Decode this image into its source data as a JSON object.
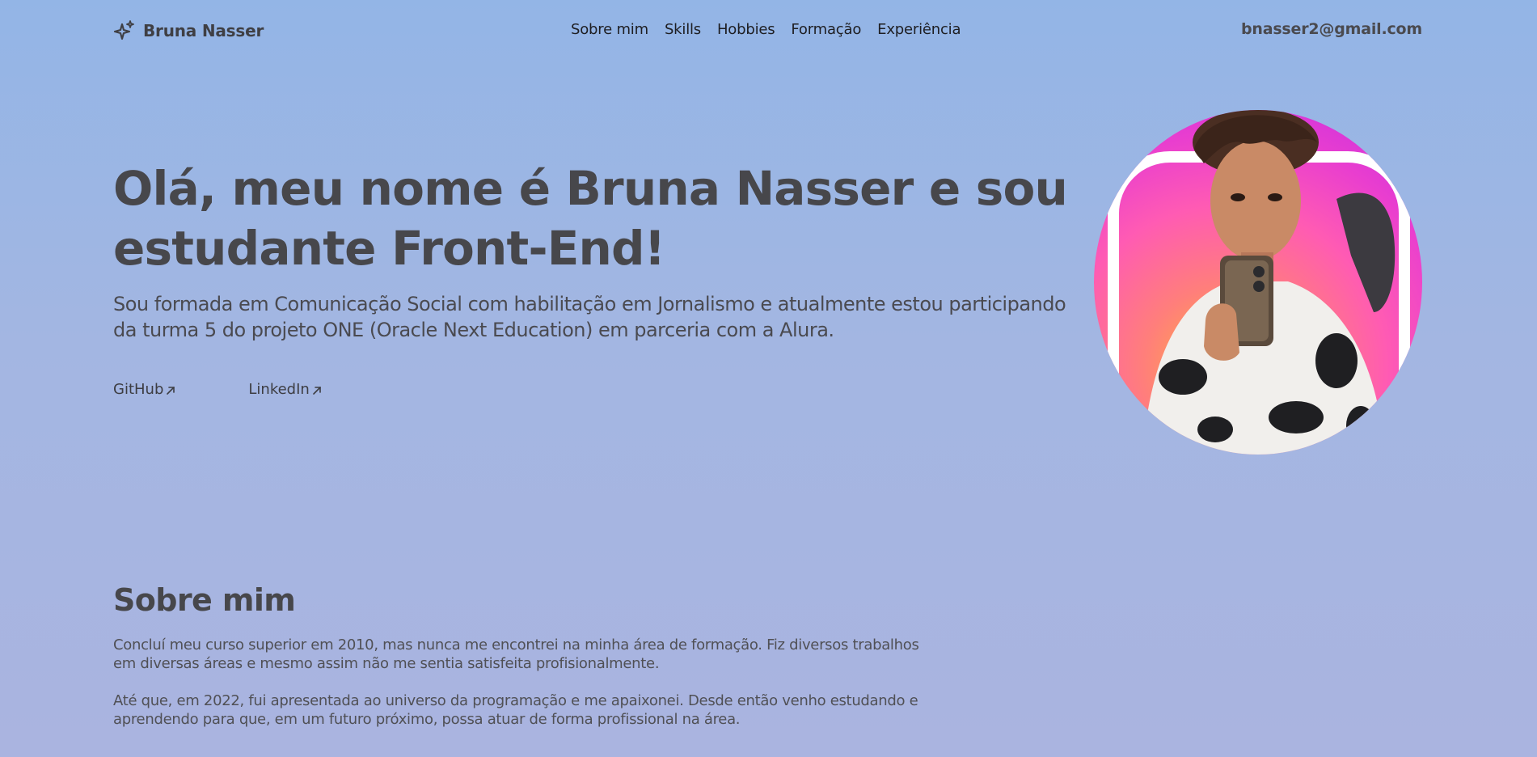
{
  "header": {
    "brand_icon": "sparkles-icon",
    "brand_name": "Bruna Nasser",
    "nav": [
      {
        "label": "Sobre mim"
      },
      {
        "label": "Skills"
      },
      {
        "label": "Hobbies"
      },
      {
        "label": "Formação"
      },
      {
        "label": "Experiência"
      }
    ],
    "email": "bnasser2@gmail.com"
  },
  "hero": {
    "title": "Olá, meu nome é Bruna Nasser e sou estudante Front-End!",
    "subtitle": "Sou formada em Comunicação Social com habilitação em Jornalismo e atualmente estou participando da turma 5 do projeto ONE (Oracle Next Education) em parceria com a Alura.",
    "links": [
      {
        "label": "GitHub",
        "icon": "arrow-up-right-icon"
      },
      {
        "label": "LinkedIn",
        "icon": "arrow-up-right-icon"
      }
    ],
    "avatar": {
      "alt": "profile-photo",
      "colors": {
        "bg_top": "#c02ce6",
        "bg_mid": "#ff5bb3",
        "bg_bottom": "#ffb43a"
      }
    }
  },
  "about": {
    "title": "Sobre mim",
    "paragraphs": [
      "Concluí meu curso superior em 2010, mas nunca me encontrei na minha área de formação. Fiz diversos trabalhos em diversas áreas e mesmo assim não me sentia satisfeita profisionalmente.",
      "Até que, em 2022, fui apresentada ao universo da programação e me apaixonei. Desde então venho estudando e aprendendo para que, em um futuro próximo, possa atuar de forma profissional na área."
    ]
  },
  "colors": {
    "background_top": "#93b5e6",
    "background_bottom": "#aab4e0",
    "text_primary": "#47474b",
    "nav_text": "#1e1e22"
  }
}
